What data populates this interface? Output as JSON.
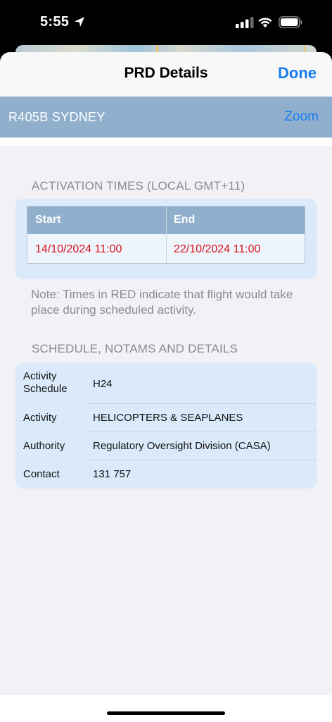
{
  "status_bar": {
    "time": "5:55",
    "icons": [
      "location-arrow-icon",
      "cellular-signal-icon",
      "wifi-icon",
      "battery-icon"
    ]
  },
  "nav": {
    "title": "PRD Details",
    "done_label": "Done"
  },
  "area": {
    "name": "R405B SYDNEY",
    "zoom_label": "Zoom"
  },
  "activation": {
    "section_title": "ACTIVATION TIMES (LOCAL GMT+11)",
    "columns": [
      "Start",
      "End"
    ],
    "start": "14/10/2024 11:00",
    "end": "22/10/2024 11:00"
  },
  "note": "Note: Times in RED indicate that flight would take place during scheduled activity.",
  "details": {
    "section_title": "SCHEDULE, NOTAMS AND DETAILS",
    "rows": [
      {
        "label_line1": "Activity",
        "label_line2": "Schedule",
        "value": "H24"
      },
      {
        "label": "Activity",
        "value": "HELICOPTERS & SEAPLANES"
      },
      {
        "label": "Authority",
        "value": "Regulatory Oversight Division (CASA)"
      },
      {
        "label": "Contact",
        "value": "131 757"
      }
    ]
  },
  "colors": {
    "accent": "#1a7cf0",
    "header_blue": "#8fafcc",
    "card_bg": "#dbeafa",
    "active_time_red": "#d8141e"
  }
}
